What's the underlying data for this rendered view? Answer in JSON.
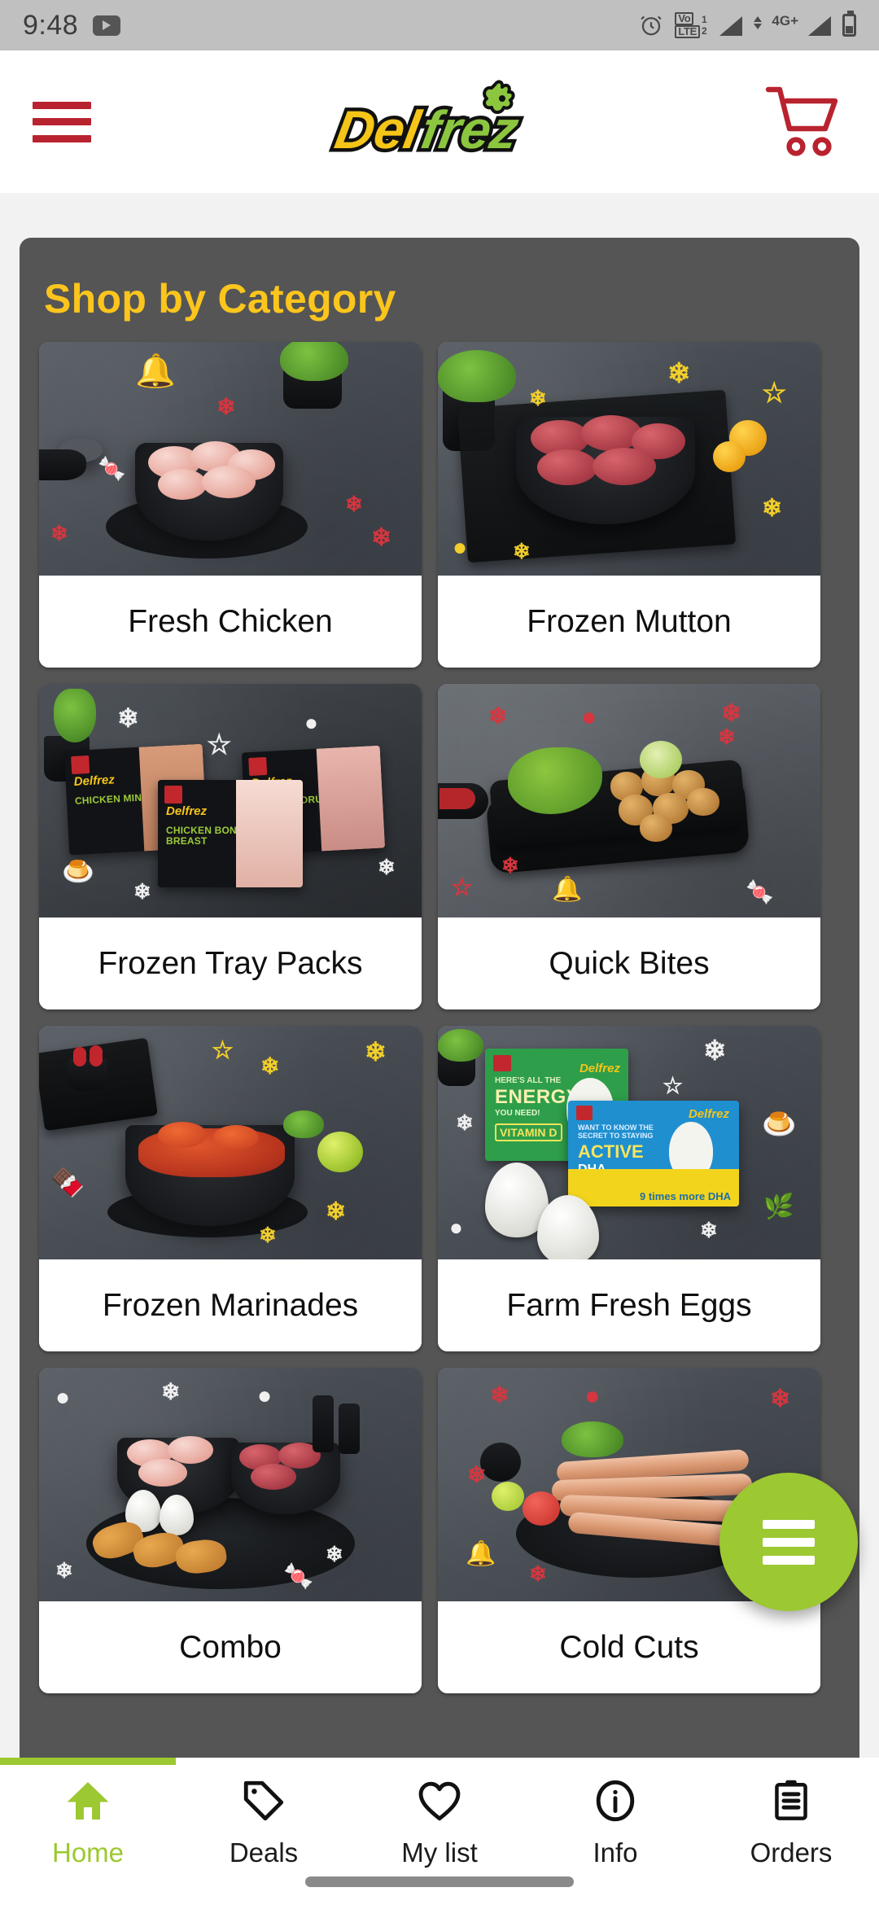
{
  "status_bar": {
    "time": "9:48",
    "icons": [
      "youtube-icon",
      "alarm-icon",
      "volte-dual-sim-icon",
      "signal-bars-icon",
      "network-4g-plus-icon",
      "battery-icon"
    ],
    "volte_label": "VoLTE",
    "sim1": "1",
    "sim2": "2",
    "network": "4G+"
  },
  "header": {
    "menu_icon": "hamburger-menu-icon",
    "logo_text": "Delfrez",
    "logo_part1": "Del",
    "logo_part2": "frez",
    "cart_icon": "shopping-cart-icon",
    "brand_yellow": "#f5c518",
    "brand_green": "#8cc63f",
    "brand_red": "#b8232f"
  },
  "section": {
    "title": "Shop by Category",
    "title_color": "#fbc51d",
    "panel_color": "#555555"
  },
  "categories": [
    {
      "label": "Fresh Chicken",
      "image": "raw-chicken-in-black-bowl",
      "doodle_color": "#d5363f"
    },
    {
      "label": "Frozen Mutton",
      "image": "raw-mutton-in-black-kadai",
      "doodle_color": "#f2cf2a"
    },
    {
      "label": "Frozen Tray Packs",
      "image": "delfrez-chicken-tray-packs",
      "doodle_color": "#f2f2f2"
    },
    {
      "label": "Quick Bites",
      "image": "fried-nuggets-on-black-tray",
      "doodle_color": "#d5363f"
    },
    {
      "label": "Frozen Marinades",
      "image": "marinated-chicken-curry-bowl",
      "doodle_color": "#f2cf2a"
    },
    {
      "label": "Farm Fresh Eggs",
      "image": "delfrez-egg-cartons",
      "doodle_color": "#f2f2f2"
    },
    {
      "label": "Combo",
      "image": "chicken-mutton-eggs-combo-platter",
      "doodle_color": "#f2f2f2"
    },
    {
      "label": "Cold Cuts",
      "image": "sausages-on-black-plate",
      "doodle_color": "#d5363f"
    }
  ],
  "pack_labels": [
    "CHICKEN MINCED MEAT",
    "CHICKEN BONELESS BREAST",
    "CHICKEN DRUMSTICK"
  ],
  "egg_carton_labels": {
    "green": "ENERGY",
    "green_sub": "VITAMIN D",
    "blue": "ACTIVE",
    "blue_sub": "DHA",
    "yellow_sub": "9 times more DHA"
  },
  "fab": {
    "icon": "menu-fab-icon",
    "color": "#9cc831"
  },
  "bottom_nav": {
    "active_color": "#9cc831",
    "items": [
      {
        "label": "Home",
        "icon": "home-icon",
        "active": true
      },
      {
        "label": "Deals",
        "icon": "tag-icon",
        "active": false
      },
      {
        "label": "My list",
        "icon": "heart-icon",
        "active": false
      },
      {
        "label": "Info",
        "icon": "info-circle-icon",
        "active": false
      },
      {
        "label": "Orders",
        "icon": "clipboard-icon",
        "active": false
      }
    ]
  }
}
